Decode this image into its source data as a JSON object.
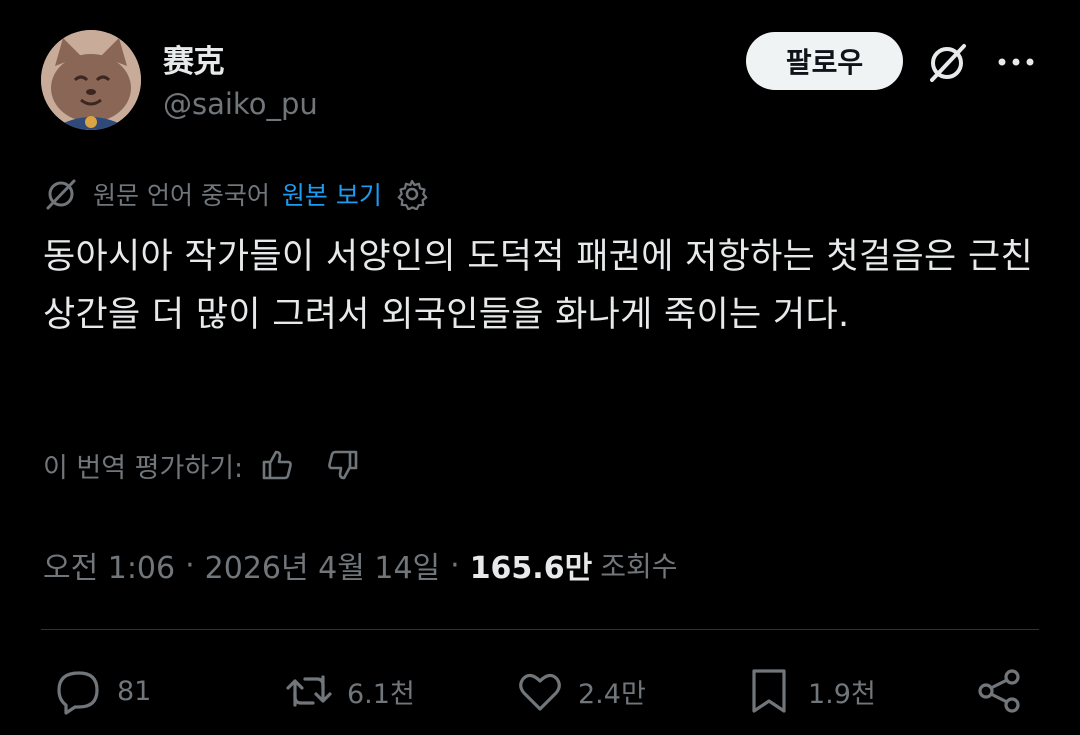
{
  "author": {
    "display_name": "赛克",
    "handle": "@saiko_pu"
  },
  "header": {
    "follow_label": "팔로우"
  },
  "translation": {
    "source_label": "원문 언어 중국어",
    "view_original_label": "원본 보기"
  },
  "tweet": {
    "text": "동아시아 작가들이 서양인의 도덕적 패권에 저항하는 첫걸음은 근친상간을 더 많이 그려서 외국인들을 화나게 죽이는 거다."
  },
  "rating": {
    "label": "이 번역 평가하기:"
  },
  "meta": {
    "time": "오전 1:06",
    "separator": "·",
    "date": "2026년 4월 14일",
    "views_count": "165.6만",
    "views_label": "조회수"
  },
  "actions": {
    "replies": "81",
    "reposts": "6.1천",
    "likes": "2.4만",
    "bookmarks": "1.9천"
  },
  "colors": {
    "background": "#000000",
    "text": "#e7e9ea",
    "muted": "#71767b",
    "link": "#1d9bf0",
    "divider": "#2f3336"
  }
}
